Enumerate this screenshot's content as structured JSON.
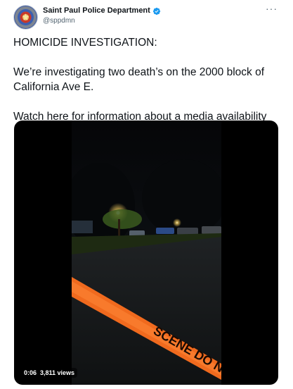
{
  "author": {
    "display_name": "Saint Paul Police Department",
    "handle": "@sppdmn",
    "verified": true,
    "avatar_icon": "police-badge-icon"
  },
  "more_icon": "ellipsis-icon",
  "more_label": "···",
  "tweet": {
    "paragraphs": [
      "HOMICIDE INVESTIGATION:",
      "We’re investigating two death’s on the 2000 block of California Ave E.",
      "Watch here for information about a media availability"
    ]
  },
  "media": {
    "type": "video",
    "timestamp": "0:06",
    "views": "3,811 views",
    "tape_text": "SCENE DO NOT CROSS"
  },
  "colors": {
    "verified_blue": "#1d9bf0",
    "text": "#0f1419",
    "secondary_text": "#536471",
    "tape_orange": "#f06a1e"
  }
}
